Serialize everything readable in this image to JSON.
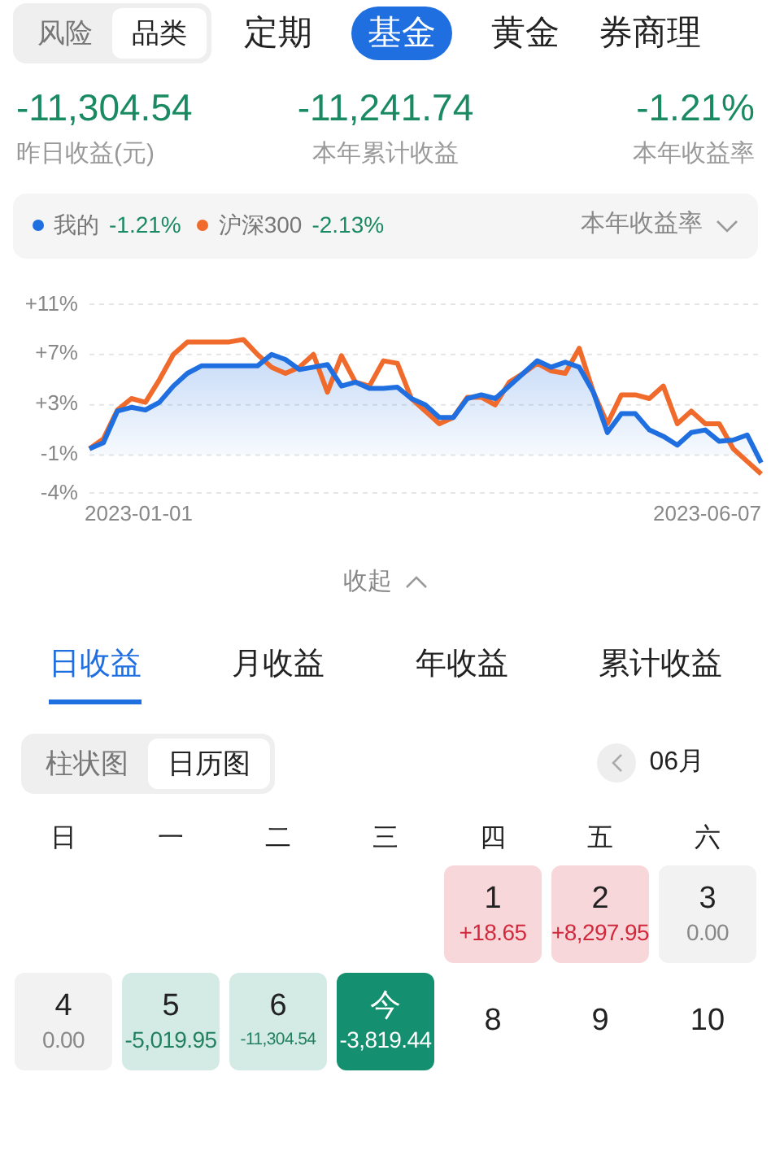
{
  "view_toggle": [
    {
      "label": "风险",
      "selected": false
    },
    {
      "label": "品类",
      "selected": true
    }
  ],
  "category_tabs": [
    {
      "label": "定期",
      "selected": false
    },
    {
      "label": "基金",
      "selected": true
    },
    {
      "label": "黄金",
      "selected": false
    },
    {
      "label": "券商理",
      "selected": false
    }
  ],
  "stats": [
    {
      "value": "-11,304.54",
      "label": "昨日收益(元)"
    },
    {
      "value": "-11,241.74",
      "label": "本年累计收益"
    },
    {
      "value": "-1.21%",
      "label": "本年收益率"
    }
  ],
  "legend": {
    "values": [
      "-1.21%",
      "-2.13%"
    ],
    "metric": "本年收益率"
  },
  "date_labels": [
    "2023-01-01",
    "2023-06-07"
  ],
  "chart_data": {
    "type": "line",
    "grid": true,
    "ylim": [
      -4,
      11
    ],
    "yticks": [
      {
        "value": 11,
        "label": "+11%"
      },
      {
        "value": 7,
        "label": "+7%"
      },
      {
        "value": 3,
        "label": "+3%"
      },
      {
        "value": -1,
        "label": "-1%"
      },
      {
        "value": -4,
        "label": "-4%"
      }
    ],
    "series": [
      {
        "name": "我的",
        "color": "#1f6fe0",
        "values": [
          -0.5,
          0,
          2.5,
          2.8,
          2.6,
          3.2,
          4.5,
          5.5,
          6.1,
          6.1,
          6.1,
          6.1,
          6.1,
          7.0,
          6.6,
          5.8,
          6.0,
          6.2,
          4.5,
          4.8,
          4.3,
          4.3,
          4.4,
          3.5,
          3.0,
          2.0,
          2.0,
          3.5,
          3.8,
          3.5,
          4.5,
          5.5,
          6.5,
          6.0,
          6.4,
          6.0,
          4.0,
          0.8,
          2.3,
          2.3,
          1.0,
          0.5,
          -0.2,
          0.8,
          1.0,
          0.1,
          0.2,
          0.6,
          -1.6
        ]
      },
      {
        "name": "沪深300",
        "color": "#f06a2b",
        "values": [
          -0.5,
          0.3,
          2.6,
          3.5,
          3.2,
          5.0,
          7.0,
          8.0,
          8.0,
          8.0,
          8.0,
          8.2,
          7.0,
          6.0,
          5.5,
          6.0,
          7.0,
          4.0,
          6.9,
          4.8,
          4.5,
          6.5,
          6.3,
          3.5,
          2.5,
          1.5,
          2.0,
          3.6,
          3.6,
          3.0,
          4.8,
          5.5,
          6.3,
          5.7,
          5.5,
          7.5,
          4.0,
          1.5,
          3.8,
          3.8,
          3.5,
          4.5,
          1.5,
          2.5,
          1.5,
          1.5,
          -0.5,
          -1.5,
          -2.5
        ]
      }
    ]
  },
  "collapse": "收起",
  "earning_tabs": [
    {
      "label": "日收益",
      "selected": true
    },
    {
      "label": "月收益",
      "selected": false
    },
    {
      "label": "年收益",
      "selected": false
    },
    {
      "label": "累计收益",
      "selected": false
    }
  ],
  "chart_toggle": [
    {
      "label": "柱状图",
      "selected": false
    },
    {
      "label": "日历图",
      "selected": true
    }
  ],
  "month": "06月",
  "weekdays": [
    "日",
    "一",
    "二",
    "三",
    "四",
    "五",
    "六"
  ],
  "days": [
    {
      "kind": "blank"
    },
    {
      "kind": "blank"
    },
    {
      "kind": "blank"
    },
    {
      "kind": "blank"
    },
    {
      "kind": "gain",
      "day": "1",
      "amount": "+18.65"
    },
    {
      "kind": "gain",
      "day": "2",
      "amount": "+8,297.95"
    },
    {
      "kind": "flat",
      "day": "3",
      "amount": "0.00"
    },
    {
      "kind": "flat",
      "day": "4",
      "amount": "0.00"
    },
    {
      "kind": "loss",
      "day": "5",
      "amount": "-5,019.95"
    },
    {
      "kind": "loss",
      "day": "6",
      "amount": "-11,304.54"
    },
    {
      "kind": "today",
      "day": "今",
      "amount": "-3,819.44"
    },
    {
      "kind": "future",
      "day": "8"
    },
    {
      "kind": "future",
      "day": "9"
    },
    {
      "kind": "future",
      "day": "10"
    }
  ]
}
